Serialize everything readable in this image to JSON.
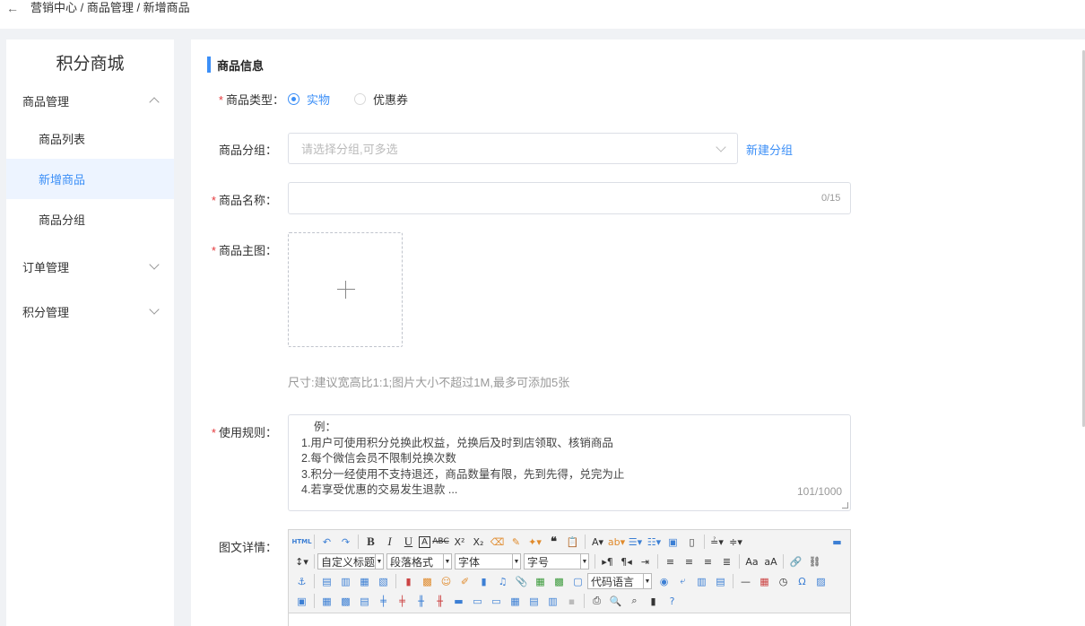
{
  "breadcrumb": {
    "back_icon": "arrow-left-icon",
    "path": "营销中心 / 商品管理 / 新增商品"
  },
  "sidebar": {
    "title": "积分商城",
    "groups": [
      {
        "label": "商品管理",
        "expanded": true,
        "items": [
          {
            "label": "商品列表",
            "active": false
          },
          {
            "label": "新增商品",
            "active": true
          },
          {
            "label": "商品分组",
            "active": false
          }
        ]
      },
      {
        "label": "订单管理",
        "expanded": false
      },
      {
        "label": "积分管理",
        "expanded": false
      }
    ]
  },
  "form": {
    "section_title": "商品信息",
    "type": {
      "label": "商品类型：",
      "options": [
        "实物",
        "优惠券"
      ],
      "selected": "实物"
    },
    "group": {
      "label": "商品分组：",
      "placeholder": "请选择分组,可多选",
      "new_link": "新建分组"
    },
    "name": {
      "label": "商品名称：",
      "value": "",
      "counter": "0/15"
    },
    "image": {
      "label": "商品主图：",
      "hint": "尺寸:建议宽高比1:1;图片大小不超过1M,最多可添加5张"
    },
    "rules": {
      "label": "使用规则：",
      "lines": [
        "例：",
        "1.用户可使用积分兑换此权益，兑换后及时到店领取、核销商品",
        "2.每个微信会员不限制兑换次数",
        "3.积分一经使用不支持退还，商品数量有限，先到先得，兑完为止",
        "4.若享受优惠的交易发生退款 ..."
      ],
      "counter": "101/1000"
    },
    "detail": {
      "label": "图文详情：",
      "combos": {
        "heading": "自定义标题",
        "paragraph": "段落格式",
        "font": "字体",
        "size": "字号",
        "code": "代码语言"
      }
    }
  },
  "colors": {
    "accent": "#3c8ff7",
    "required": "#e4393c",
    "active_bg": "#edf4ff"
  }
}
